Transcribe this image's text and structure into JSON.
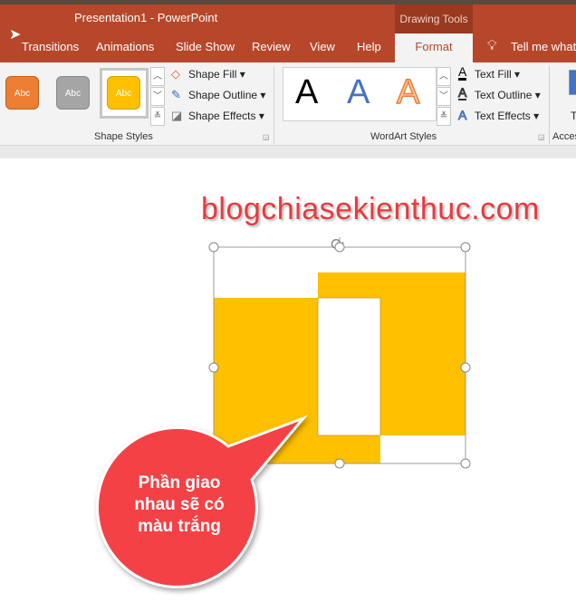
{
  "window": {
    "title": "Presentation1  -  PowerPoint",
    "context_tab": "Drawing Tools"
  },
  "tabs": [
    "Transitions",
    "Animations",
    "Slide Show",
    "Review",
    "View",
    "Help",
    "Format"
  ],
  "tell_me": "Tell me what y",
  "shape_styles": {
    "swatches": [
      {
        "label": "Abc",
        "color": "#ed7d31"
      },
      {
        "label": "Abc",
        "color": "#a5a5a5"
      },
      {
        "label": "Abc",
        "color": "#ffc000"
      }
    ],
    "buttons": [
      "Shape Fill",
      "Shape Outline",
      "Shape Effects"
    ],
    "group_label": "Shape Styles"
  },
  "wordart": {
    "samples": [
      "A",
      "A",
      "A"
    ],
    "buttons": [
      "Text Fill",
      "Text Outline",
      "Text Effects"
    ],
    "group_label": "WordArt Styles"
  },
  "accessibility": {
    "group_label": "Acces",
    "partial": "T"
  },
  "slide": {
    "watermark": "blogchiasekienthuc.com",
    "callout": [
      "Phần giao",
      "nhau sẽ có",
      "màu trắng"
    ],
    "shape_color": "#ffc000",
    "callout_color": "#f44146"
  }
}
